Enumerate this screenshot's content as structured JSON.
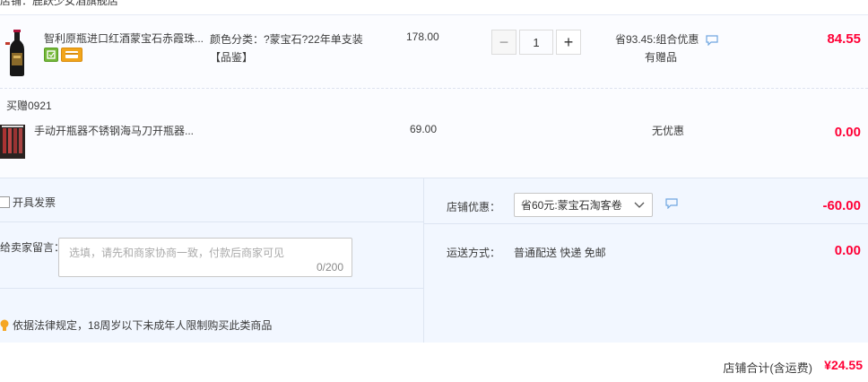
{
  "shop": {
    "name": "店铺：鹿跃少女酒旗舰店"
  },
  "items": [
    {
      "title": "智利原瓶进口红酒蒙宝石赤霞珠...",
      "sku_label": "颜色分类：?蒙宝石?22年单支装",
      "sku_tag": "【品鉴】",
      "price": "178.00",
      "quantity": "1",
      "promo": "省93.45:组合优惠",
      "gift_note": "有赠品",
      "subtotal": "84.55"
    },
    {
      "title": "手动开瓶器不锈钢海马刀开瓶器...",
      "price": "69.00",
      "promo": "无优惠",
      "subtotal": "0.00"
    }
  ],
  "gift_section_label": "买赠0921",
  "invoice": {
    "label": "开具发票"
  },
  "message": {
    "label": "给卖家留言：",
    "placeholder": "选填，请先和商家协商一致，付款后商家可见",
    "counter": "0/200"
  },
  "law_notice": "依据法律规定，18周岁以下未成年人限制购买此类商品",
  "shop_discount": {
    "label": "店铺优惠：",
    "selected": "省60元:蒙宝石淘客卷",
    "value": "-60.00"
  },
  "shipping": {
    "label": "运送方式：",
    "method": "普通配送 快递 免邮",
    "cost": "0.00"
  },
  "total": {
    "label": "店铺合计(含运费)",
    "value": "¥24.55"
  },
  "colors": {
    "accent_red": "#ff0036",
    "panel_bg": "#f2f7ff"
  }
}
